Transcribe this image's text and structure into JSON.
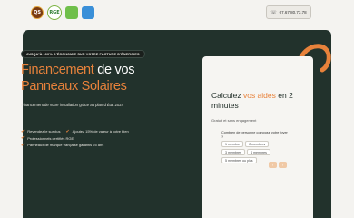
{
  "header": {
    "logos": [
      {
        "icon": "certification-seal-logo",
        "text": "QS"
      },
      {
        "icon": "rge-qualipv-logo",
        "text": "RGE"
      },
      {
        "icon": "green-partner-logo",
        "text": ""
      },
      {
        "icon": "blue-partner-logo",
        "text": ""
      }
    ],
    "phone": {
      "icon": "phone-icon",
      "number": "07.67.80.73.78"
    }
  },
  "hero": {
    "badge": "JUSQU'À 100% D'ÉCONOMIE SUR VOTRE FACTURE D'ÉNERGIES",
    "title_accent_1": "Financement",
    "title_plain": " de vos ",
    "title_accent_2": "Panneaux Solaires",
    "subtitle": "Financement de votre installation grâce au plan d'État 2024",
    "features": [
      [
        "Revendez le surplus",
        "Ajoutez 15% de valeur à votre bien"
      ],
      [
        "Professionnels certifiés RGE"
      ],
      [
        "Panneaux de marque française garantis 25 ans"
      ]
    ],
    "colors": {
      "background": "#22322c",
      "accent": "#e8823b"
    }
  },
  "card": {
    "title_prefix": "Calculez ",
    "title_accent": "vos aides",
    "title_suffix": " en 2 minutes",
    "subtitle": "Gratuit et sans engagement",
    "question": "Combien de personne compose votre foyer ?",
    "options": [
      "1 membre",
      "2 membres",
      "3 membres",
      "4 membres",
      "5 membres ou plus"
    ],
    "nav": {
      "prev": "‹",
      "next": "›"
    }
  }
}
